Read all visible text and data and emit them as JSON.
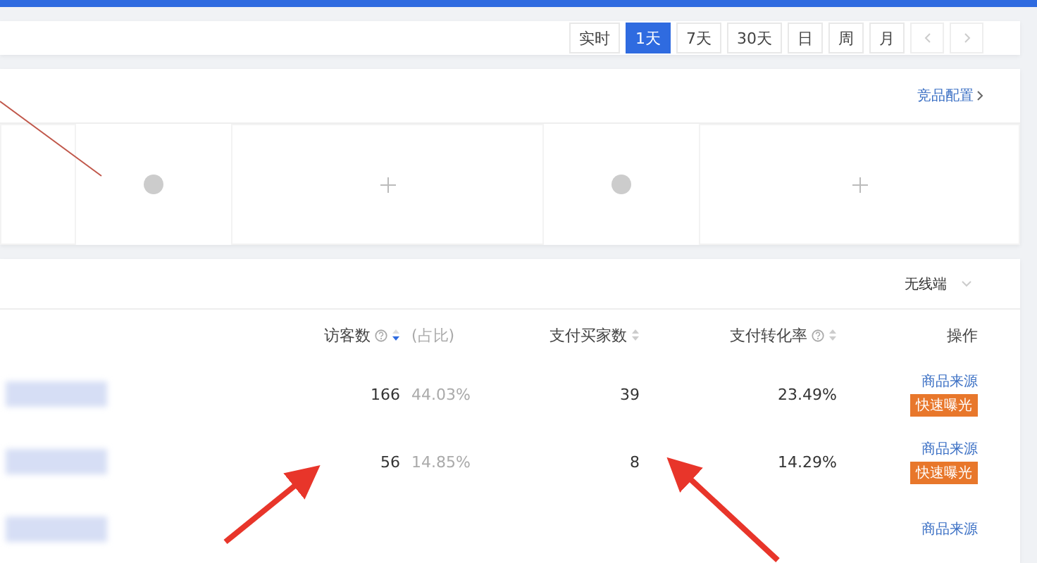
{
  "date_range": [
    {
      "label": "实时",
      "selected": false
    },
    {
      "label": "1天",
      "selected": true
    },
    {
      "label": "7天",
      "selected": false
    },
    {
      "label": "30天",
      "selected": false
    },
    {
      "label": "日",
      "selected": false
    },
    {
      "label": "周",
      "selected": false
    },
    {
      "label": "月",
      "selected": false
    }
  ],
  "competitor_panel": {
    "config_link": "竞品配置"
  },
  "table_panel": {
    "terminal": "无线端",
    "columns": [
      {
        "label": "访客数",
        "help": true,
        "sortable": true,
        "sorted": true
      },
      {
        "label": "(占比)",
        "help": false,
        "sortable": false
      },
      {
        "label": "支付买家数",
        "help": false,
        "sortable": true,
        "sorted": false
      },
      {
        "label": "支付转化率",
        "help": true,
        "sortable": true,
        "sorted": false
      },
      {
        "label": "操作",
        "help": false,
        "sortable": false
      }
    ],
    "rows": [
      {
        "visitors": "166",
        "share": "44.03%",
        "buyers": "39",
        "conversion": "23.49%",
        "source_link": "商品来源",
        "action": "快速曝光"
      },
      {
        "visitors": "56",
        "share": "14.85%",
        "buyers": "8",
        "conversion": "14.29%",
        "source_link": "商品来源",
        "action": "快速曝光"
      },
      {
        "source_link": "商品来源"
      }
    ]
  }
}
